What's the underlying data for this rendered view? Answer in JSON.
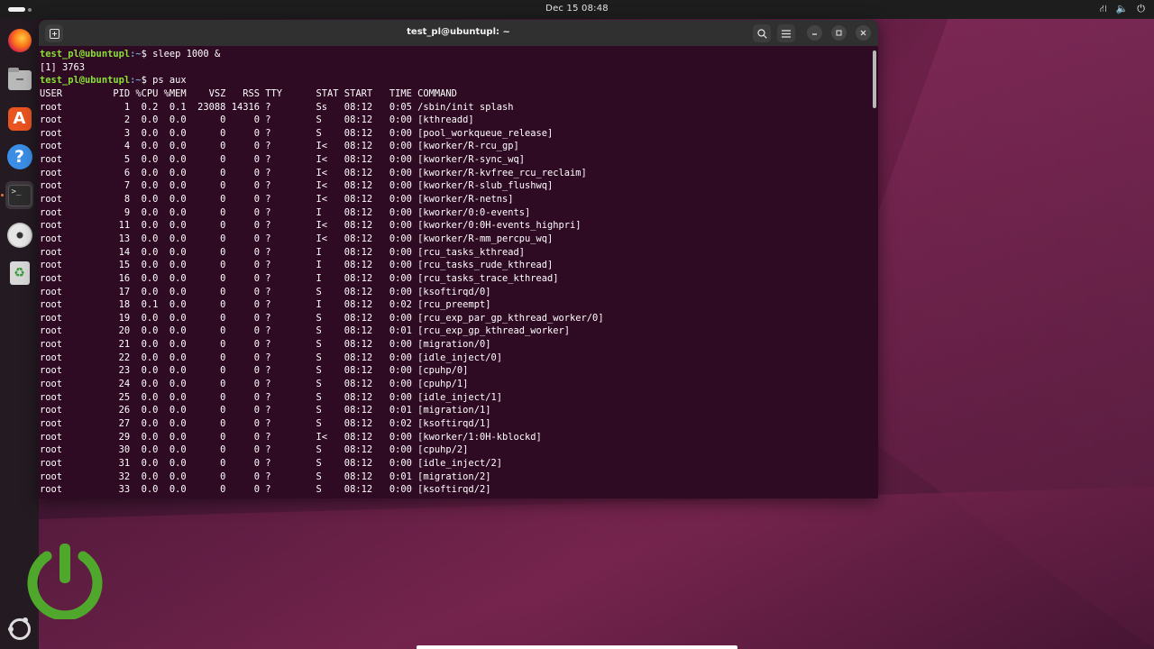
{
  "topbar": {
    "clock": "Dec 15  08:48",
    "tray_icons": [
      "network-icon",
      "volume-icon",
      "power-icon"
    ]
  },
  "dock": {
    "items": [
      {
        "name": "Firefox",
        "icon": "firefox-icon"
      },
      {
        "name": "Files",
        "icon": "files-icon"
      },
      {
        "name": "App Center",
        "icon": "app-center-icon",
        "glyph": "A"
      },
      {
        "name": "Help",
        "icon": "help-icon",
        "glyph": "?"
      },
      {
        "name": "Terminal",
        "icon": "terminal-icon",
        "glyph": ">_"
      },
      {
        "name": "Disc",
        "icon": "disc-icon"
      },
      {
        "name": "Trash",
        "icon": "trash-icon",
        "glyph": "♻"
      },
      {
        "name": "Show Apps",
        "icon": "show-apps-icon"
      }
    ]
  },
  "terminal": {
    "title": "test_pl@ubuntupl: ~",
    "prompt_user": "test_pl@ubuntupl",
    "prompt_path": ":~",
    "prompt_symbol": "$ ",
    "command1": "sleep 1000 &",
    "job_output": "[1] 3763",
    "command2": "ps aux",
    "header": "USER         PID %CPU %MEM    VSZ   RSS TTY      STAT START   TIME COMMAND",
    "rows": [
      "root           1  0.2  0.1  23088 14316 ?        Ss   08:12   0:05 /sbin/init splash",
      "root           2  0.0  0.0      0     0 ?        S    08:12   0:00 [kthreadd]",
      "root           3  0.0  0.0      0     0 ?        S    08:12   0:00 [pool_workqueue_release]",
      "root           4  0.0  0.0      0     0 ?        I<   08:12   0:00 [kworker/R-rcu_gp]",
      "root           5  0.0  0.0      0     0 ?        I<   08:12   0:00 [kworker/R-sync_wq]",
      "root           6  0.0  0.0      0     0 ?        I<   08:12   0:00 [kworker/R-kvfree_rcu_reclaim]",
      "root           7  0.0  0.0      0     0 ?        I<   08:12   0:00 [kworker/R-slub_flushwq]",
      "root           8  0.0  0.0      0     0 ?        I<   08:12   0:00 [kworker/R-netns]",
      "root           9  0.0  0.0      0     0 ?        I    08:12   0:00 [kworker/0:0-events]",
      "root          11  0.0  0.0      0     0 ?        I<   08:12   0:00 [kworker/0:0H-events_highpri]",
      "root          13  0.0  0.0      0     0 ?        I<   08:12   0:00 [kworker/R-mm_percpu_wq]",
      "root          14  0.0  0.0      0     0 ?        I    08:12   0:00 [rcu_tasks_kthread]",
      "root          15  0.0  0.0      0     0 ?        I    08:12   0:00 [rcu_tasks_rude_kthread]",
      "root          16  0.0  0.0      0     0 ?        I    08:12   0:00 [rcu_tasks_trace_kthread]",
      "root          17  0.0  0.0      0     0 ?        S    08:12   0:00 [ksoftirqd/0]",
      "root          18  0.1  0.0      0     0 ?        I    08:12   0:02 [rcu_preempt]",
      "root          19  0.0  0.0      0     0 ?        S    08:12   0:00 [rcu_exp_par_gp_kthread_worker/0]",
      "root          20  0.0  0.0      0     0 ?        S    08:12   0:01 [rcu_exp_gp_kthread_worker]",
      "root          21  0.0  0.0      0     0 ?        S    08:12   0:00 [migration/0]",
      "root          22  0.0  0.0      0     0 ?        S    08:12   0:00 [idle_inject/0]",
      "root          23  0.0  0.0      0     0 ?        S    08:12   0:00 [cpuhp/0]",
      "root          24  0.0  0.0      0     0 ?        S    08:12   0:00 [cpuhp/1]",
      "root          25  0.0  0.0      0     0 ?        S    08:12   0:00 [idle_inject/1]",
      "root          26  0.0  0.0      0     0 ?        S    08:12   0:01 [migration/1]",
      "root          27  0.0  0.0      0     0 ?        S    08:12   0:02 [ksoftirqd/1]",
      "root          29  0.0  0.0      0     0 ?        I<   08:12   0:00 [kworker/1:0H-kblockd]",
      "root          30  0.0  0.0      0     0 ?        S    08:12   0:00 [cpuhp/2]",
      "root          31  0.0  0.0      0     0 ?        S    08:12   0:00 [idle_inject/2]",
      "root          32  0.0  0.0      0     0 ?        S    08:12   0:01 [migration/2]",
      "root          33  0.0  0.0      0     0 ?        S    08:12   0:00 [ksoftirqd/2]"
    ]
  },
  "colors": {
    "terminal_bg": "#2f0a23",
    "prompt_user": "#8ae234",
    "prompt_path": "#729fcf",
    "power_logo": "#4fa82c"
  }
}
